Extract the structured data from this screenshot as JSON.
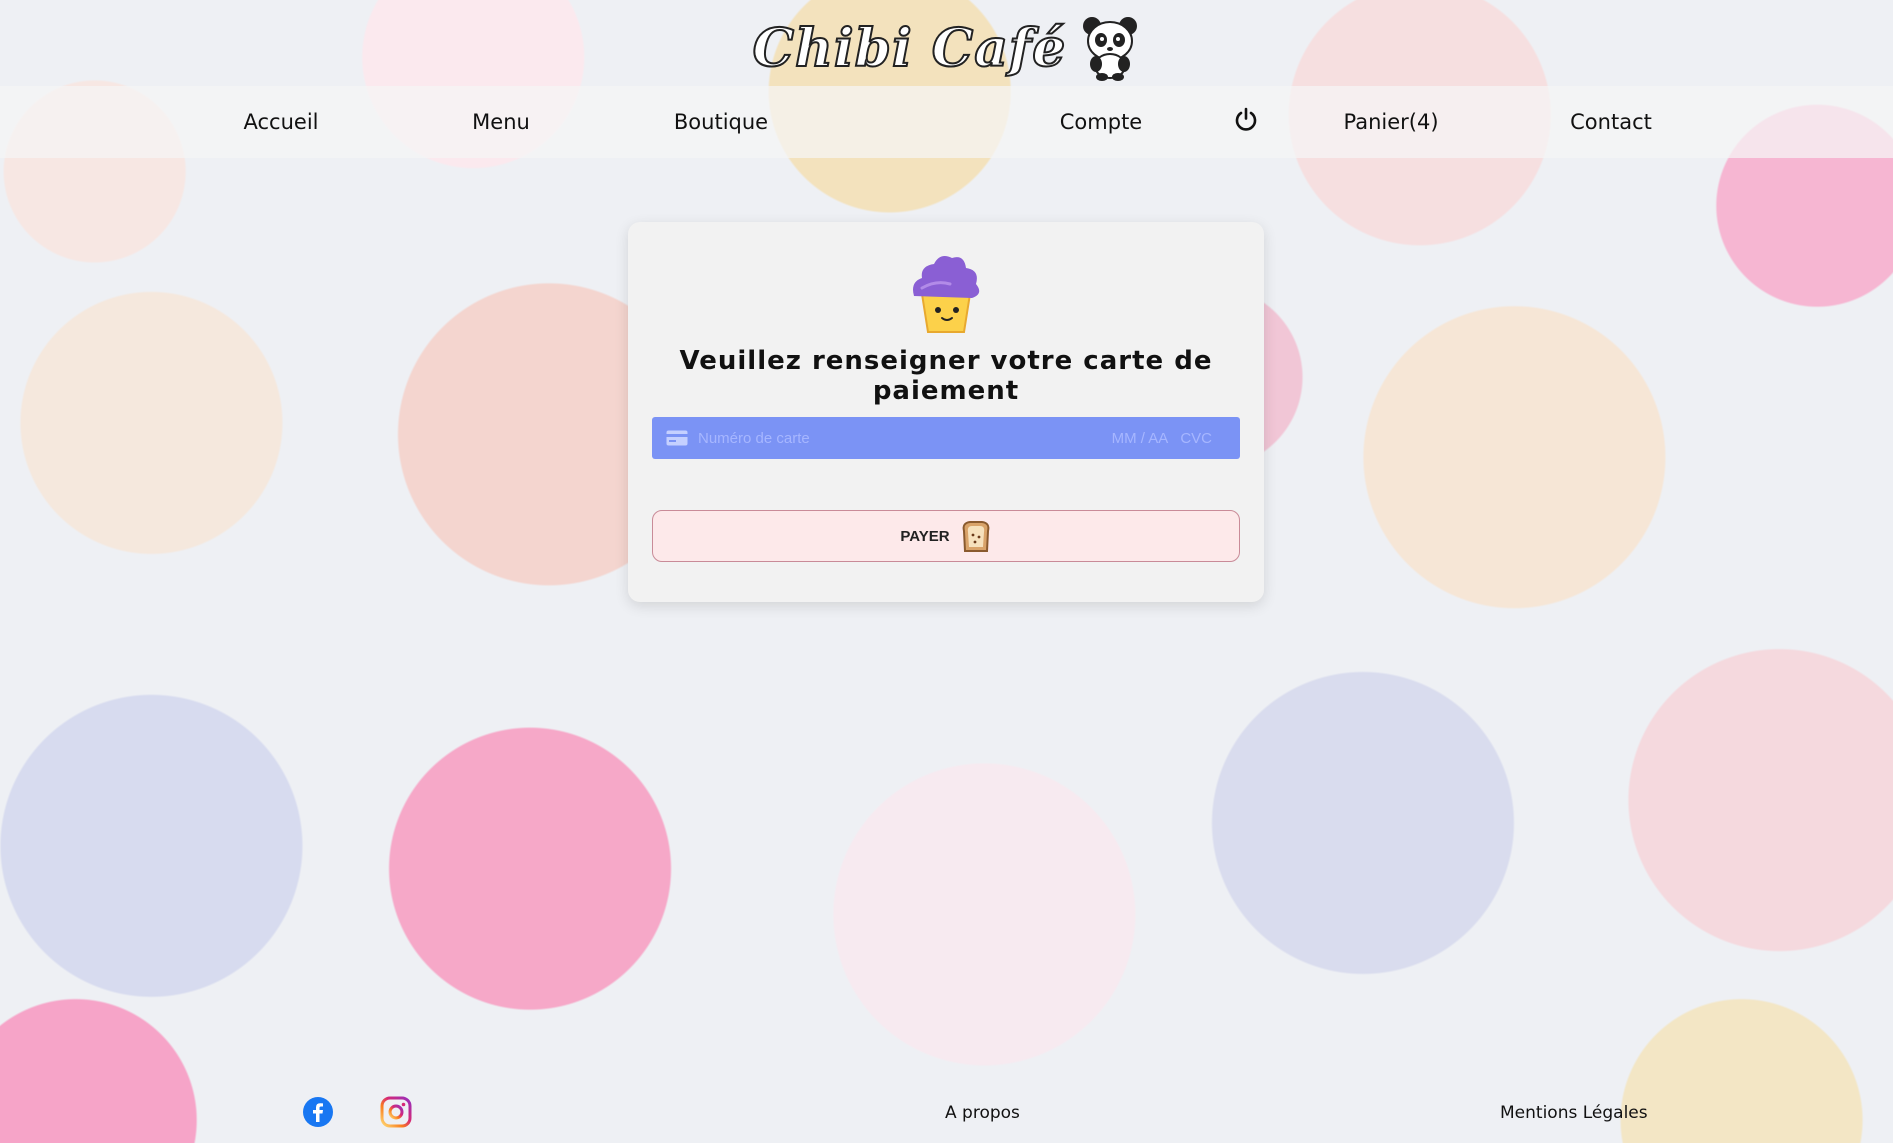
{
  "brand": {
    "title": "Chibi Café",
    "mascot_icon": "panda-icon"
  },
  "nav": {
    "items": [
      {
        "label": "Accueil"
      },
      {
        "label": "Menu"
      },
      {
        "label": "Boutique"
      },
      {
        "label": "Compte"
      },
      {
        "label": ""
      },
      {
        "label": "Panier(4)"
      },
      {
        "label": "Contact"
      }
    ],
    "power_icon": "power-icon"
  },
  "payment": {
    "title": "Veuillez renseigner votre carte de paiement",
    "card_number_placeholder": "Numéro de carte",
    "expiry_placeholder": "MM / AA",
    "cvc_placeholder": "CVC",
    "pay_label": "PAYER",
    "field_color": "#7b93f5",
    "button_color": "#fde9ea"
  },
  "footer": {
    "about_label": "A propos",
    "legal_label": "Mentions Légales"
  }
}
